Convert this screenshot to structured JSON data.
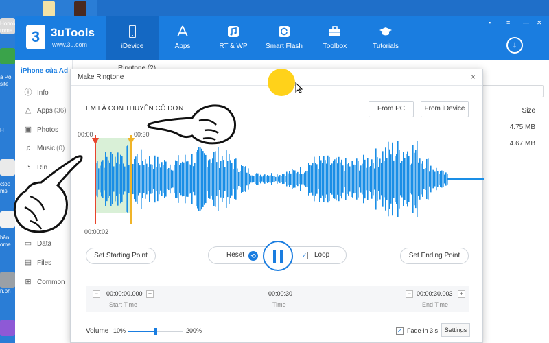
{
  "desktop": {
    "icons": [
      "Honok",
      "rome",
      "a Po",
      "site",
      "H",
      "ctop",
      "ms",
      "hân",
      "ome",
      "n.ph"
    ]
  },
  "app": {
    "brand": "3uTools",
    "brand_url": "www.3u.com",
    "logo_char": "3",
    "nav": [
      {
        "label": "iDevice",
        "icon": "phone-icon"
      },
      {
        "label": "Apps",
        "icon": "app-store-icon"
      },
      {
        "label": "RT & WP",
        "icon": "music-note-icon"
      },
      {
        "label": "Smart Flash",
        "icon": "refresh-icon"
      },
      {
        "label": "Toolbox",
        "icon": "toolbox-icon"
      },
      {
        "label": "Tutorials",
        "icon": "graduation-cap-icon"
      }
    ],
    "download_symbol": "↓",
    "window_buttons": [
      "▪",
      "≡",
      "—",
      "✕"
    ]
  },
  "sidebar": {
    "device": "iPhone của Ad",
    "items": [
      {
        "label": "Info",
        "icon": "ⓘ",
        "count": ""
      },
      {
        "label": "Apps",
        "icon": "△",
        "count": "(36)"
      },
      {
        "label": "Photos",
        "icon": "▣",
        "count": ""
      },
      {
        "label": "Music",
        "icon": "♫",
        "count": "(0)"
      },
      {
        "label": "Rin",
        "icon": "◔",
        "count": ""
      },
      {
        "label": "Data",
        "icon": "▭",
        "count": ""
      },
      {
        "label": "Files",
        "icon": "▤",
        "count": ""
      },
      {
        "label": "Common",
        "icon": "⊞",
        "count": ""
      }
    ]
  },
  "background_list": {
    "header": "Ringtone (2)",
    "size_header": "Size",
    "sizes": [
      "4.75 MB",
      "4.67 MB"
    ]
  },
  "modal": {
    "title": "Make Ringtone",
    "close": "×",
    "song_title": "EM LÀ CON THUYỀN CÔ ĐƠN",
    "from_pc": "From PC",
    "from_idevice": "From iDevice",
    "time_start_label": "00:00",
    "time_end_label": "00:30",
    "current_time": "00:00:02",
    "set_start": "Set Starting Point",
    "set_end": "Set Ending Point",
    "reset": "Reset",
    "reset_symbol": "⟲",
    "loop": "Loop",
    "loop_checked": "✓",
    "start_time_value": "00:00:00.000",
    "start_time_caption": "Start Time",
    "duration_value": "00:00:30",
    "duration_caption": "Time",
    "end_time_value": "00:00:30.003",
    "end_time_caption": "End Time",
    "minus": "−",
    "plus": "+",
    "volume_label": "Volume",
    "volume_min": "10%",
    "volume_max": "200%",
    "volume_level": 0.5,
    "fade_label": "Fade-in 3 s",
    "fade_checked": "✓",
    "settings": "Settings"
  },
  "colors": {
    "accent": "#1a7de0",
    "wave": "#1a8ee6",
    "start_marker": "#e8452c",
    "end_marker": "#f0b429",
    "selection": "#cfeccd"
  }
}
